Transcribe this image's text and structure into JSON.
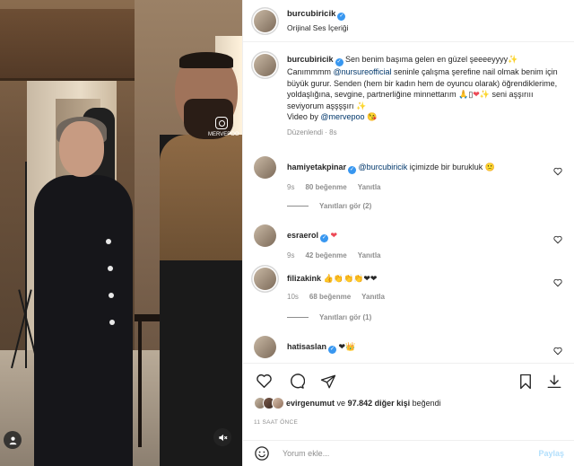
{
  "media": {
    "watermark": "MERVEPOO"
  },
  "header": {
    "username": "burcubiricik",
    "audio": "Orijinal Ses İçeriği"
  },
  "caption": {
    "username": "burcubiricik",
    "text_1": "Sen benim başıma gelen en güzel şeeeeyyyy",
    "text_2": "Canımmmm",
    "mention_1": "@nursureofficial",
    "text_3": "seninle çalışma şerefine nail olmak benim için büyük gurur. Senden (hem bir kadın hem de oyuncu olarak) öğrendiklerime, yoldaşlığına, sevgine, partnerliğine minnettarım",
    "text_4": "seni aşşırııı seviyorum aşşşşırı",
    "text_5": "Video by",
    "mention_2": "@mervepoo",
    "meta": "Düzenlendi · 8s"
  },
  "comments": [
    {
      "username": "hamiyetakpinar",
      "mention": "@burcubiricik",
      "text": "içimizde bir burukluk",
      "emoji": "🙁",
      "age": "9s",
      "likes": "80 beğenme",
      "reply": "Yanıtla",
      "replies": "Yanıtları gör (2)"
    },
    {
      "username": "esraerol",
      "mention": "",
      "text": "",
      "emoji": "❤",
      "age": "9s",
      "likes": "42 beğenme",
      "reply": "Yanıtla",
      "replies": ""
    },
    {
      "username": "filizakink",
      "mention": "",
      "text": "",
      "emoji": "👍👏👏👏❤❤",
      "age": "10s",
      "likes": "68 beğenme",
      "reply": "Yanıtla",
      "replies": "Yanıtları gör (1)"
    },
    {
      "username": "hatisaslan",
      "mention": "",
      "text": "",
      "emoji": "❤👑",
      "age": "",
      "likes": "",
      "reply": "",
      "replies": ""
    }
  ],
  "likes": {
    "first_user": "evirgenumut",
    "connector": "ve",
    "others": "97.842 diğer kişi",
    "suffix": "beğendi"
  },
  "time": "11 SAAT ÖNCE",
  "composer": {
    "placeholder": "Yorum ekle...",
    "post_label": "Paylaş"
  },
  "colors": {
    "verified": "#3897f0",
    "heart": "#ed4956",
    "mention": "#00376b",
    "post_disabled": "#b2dffc",
    "muted": "#8e8e8e"
  },
  "icons": [
    "instagram-icon",
    "user-tag-icon",
    "mute-icon",
    "verified-icon",
    "heart-icon",
    "comment-icon",
    "share-icon",
    "save-icon",
    "download-icon",
    "emoji-icon"
  ]
}
